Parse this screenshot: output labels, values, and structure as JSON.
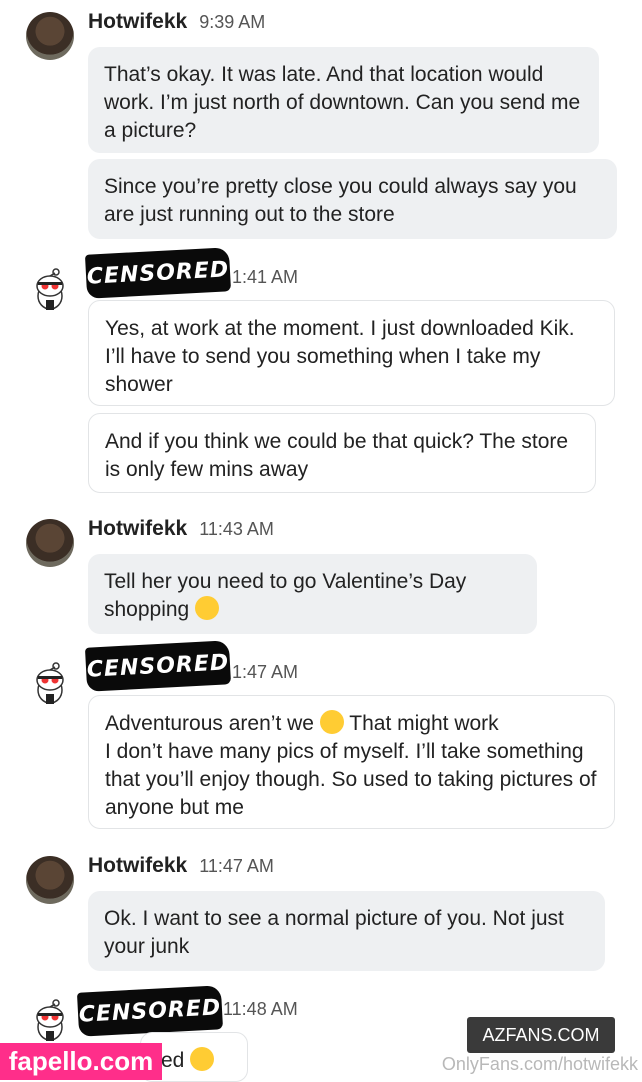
{
  "messages": [
    {
      "sender": "Hotwifekk",
      "time": "9:39 AM",
      "bubbles": [
        "That’s okay. It was late. And that location would work. I’m just north of downtown. Can you send me a picture?",
        "Since you’re pretty close you could always say you are just running out to the store"
      ]
    },
    {
      "sender_censored": "CENSORED",
      "time": "1:41 AM",
      "bubbles": [
        "Yes, at work at the moment. I just downloaded Kik. I’ll have to send you something when I take my shower",
        "And if you think we could be that quick? The store is only few mins away"
      ]
    },
    {
      "sender": "Hotwifekk",
      "time": "11:43 AM",
      "bubbles": [
        "Tell her you need to go Valentine’s Day shopping"
      ]
    },
    {
      "sender_censored": "CENSORED",
      "time": "1:47 AM",
      "bubbles": [
        "Adventurous aren’t we",
        "That might work",
        "I don’t have many pics of myself. I’ll take something that you’ll enjoy though. So used to taking pictures of anyone but me"
      ]
    },
    {
      "sender": "Hotwifekk",
      "time": "11:47 AM",
      "bubbles": [
        "Ok. I want to see a normal picture of you. Not just your junk"
      ]
    },
    {
      "sender_censored": "CENSORED",
      "time": "11:48 AM",
      "bubbles": [
        "ed"
      ]
    }
  ],
  "watermarks": {
    "azfans": "AZFANS.COM",
    "onlyfans": "OnlyFans.com/hotwifekk",
    "fapello": "fapello.com"
  }
}
